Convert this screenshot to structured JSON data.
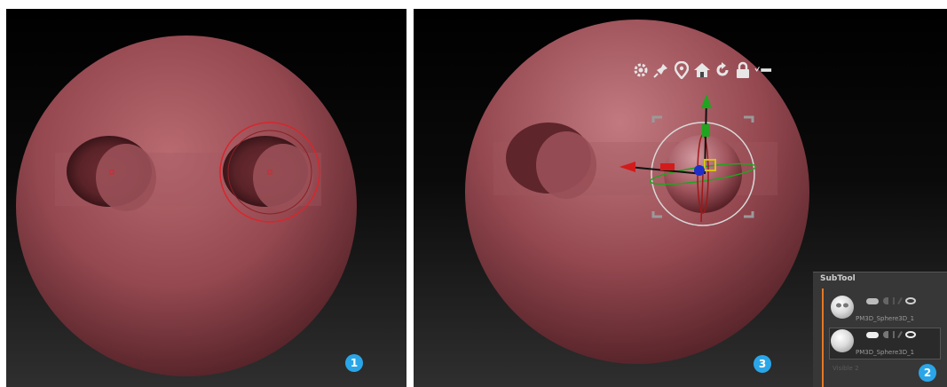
{
  "badges": {
    "left": "1",
    "right": "3",
    "subtool": "2"
  },
  "colors": {
    "sphere_base": "#8a3f44",
    "sphere_highlight": "#c58085",
    "brush_ring": "#d8262c",
    "gizmo_ring": "#d9d9d9",
    "axis_y": "#1fa51f",
    "axis_x": "#d31b1b",
    "axis_z": "#1f2fc8",
    "accent_orange": "#e57622",
    "badge_blue": "#2aa6e8"
  },
  "gizmo_toolbar": {
    "icons": [
      "gear-icon",
      "pin-icon",
      "location-pin-icon",
      "home-icon",
      "reset-icon",
      "lock-icon",
      "collapse-icon"
    ]
  },
  "subtool": {
    "title": "SubTool",
    "items": [
      {
        "name": "PM3D_Sphere3D_1",
        "thumb": "sphere-with-eyes-icon"
      },
      {
        "name": "PM3D_Sphere3D_1",
        "thumb": "sphere-icon"
      }
    ],
    "footer": "Visible 2"
  }
}
